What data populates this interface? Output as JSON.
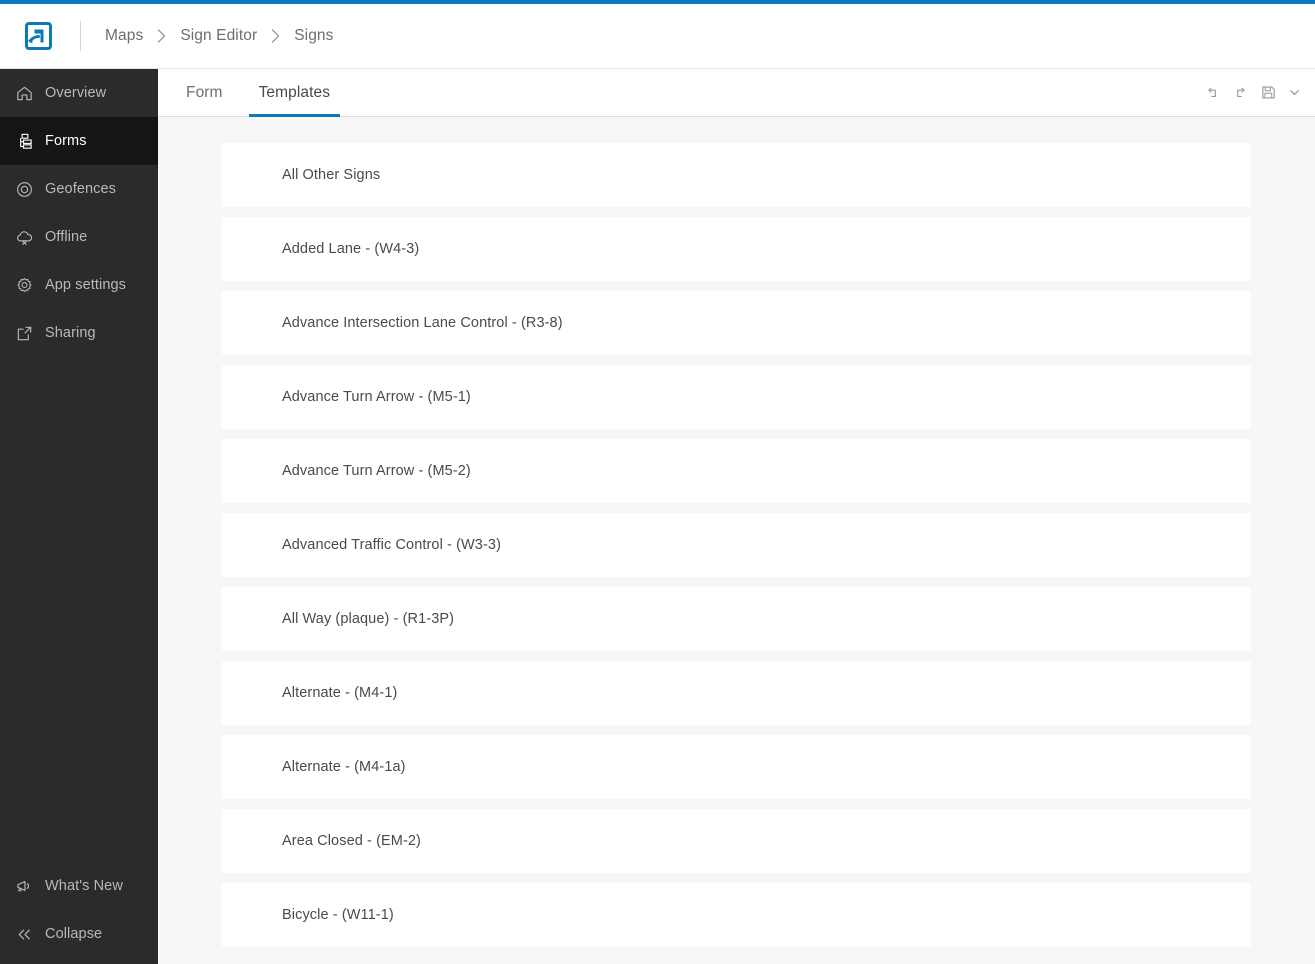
{
  "window": {
    "title": "Sign Editor",
    "accent_color": "#0b7ab8",
    "sidebar_bg": "#2b2b2b",
    "content_bg": "#f7f7f7"
  },
  "header": {
    "logo_icon": "field-maps-logo-icon",
    "breadcrumb": [
      {
        "label": "Maps",
        "icon": ""
      },
      {
        "label": "Sign Editor",
        "icon": ""
      },
      {
        "label": "Signs",
        "icon": ""
      }
    ],
    "separator_icon": "chevron-right-icon"
  },
  "sidebar": {
    "items": [
      {
        "label": "Overview",
        "icon": "home-icon",
        "active": false
      },
      {
        "label": "Forms",
        "icon": "form-tree-icon",
        "active": true
      },
      {
        "label": "Geofences",
        "icon": "geofence-icon",
        "active": false
      },
      {
        "label": "Offline",
        "icon": "cloud-off-icon",
        "active": false
      },
      {
        "label": "App settings",
        "icon": "gear-icon",
        "active": false
      },
      {
        "label": "Sharing",
        "icon": "share-icon",
        "active": false
      }
    ],
    "bottom_items": [
      {
        "label": "What's New",
        "icon": "megaphone-icon"
      },
      {
        "label": "Collapse",
        "icon": "chevron-double-left-icon"
      }
    ]
  },
  "main": {
    "tabs": [
      {
        "label": "Form",
        "active": false
      },
      {
        "label": "Templates",
        "active": true
      }
    ],
    "actions": [
      {
        "name": "undo",
        "icon": "undo-icon",
        "title": "Undo"
      },
      {
        "name": "redo",
        "icon": "redo-icon",
        "title": "Redo"
      },
      {
        "name": "save",
        "icon": "save-icon",
        "title": "Save"
      },
      {
        "name": "save-options",
        "icon": "chevron-down-icon",
        "title": "Save options"
      }
    ],
    "templates": [
      {
        "label": "All Other Signs"
      },
      {
        "label": "Added Lane - (W4-3)"
      },
      {
        "label": "Advance Intersection Lane Control - (R3-8)"
      },
      {
        "label": "Advance Turn Arrow - (M5-1)"
      },
      {
        "label": "Advance Turn Arrow - (M5-2)"
      },
      {
        "label": "Advanced Traffic Control - (W3-3)"
      },
      {
        "label": "All Way (plaque) - (R1-3P)"
      },
      {
        "label": "Alternate - (M4-1)"
      },
      {
        "label": "Alternate - (M4-1a)"
      },
      {
        "label": "Area Closed - (EM-2)"
      },
      {
        "label": "Bicycle - (W11-1)"
      }
    ]
  }
}
